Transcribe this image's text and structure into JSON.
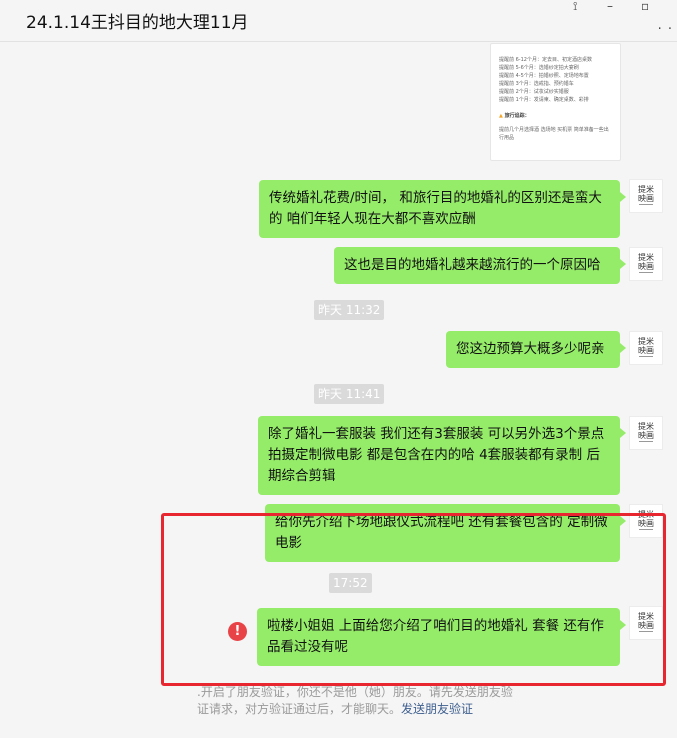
{
  "window": {
    "title": "24.1.14王抖目的地大理11月",
    "pin_glyph": "⟟",
    "minimize_glyph": "–",
    "maximize_glyph": "▫",
    "more_glyph": "· ·"
  },
  "avatar": {
    "line1": "提米",
    "line2": "映画"
  },
  "preview_card": {
    "lines": [
      "提醒前 6-12个月：定去目、初定酒店桌数",
      "提醒前 5-6个月：选婚纱定拍大宴刷",
      "提醒前 4-5个月：拍婚纱照、定场地布置",
      "提醒前 3个月：选戒指、预约婚车",
      "提醒前 2个月：试妆试纱实婚服",
      "提醒前 1个月：发请柬、确定桌数、彩排"
    ],
    "warn_title": "旅行追踪：",
    "tail_text": "提前几个月选择酒 选场地 买机票 简单准备一些出行用品"
  },
  "messages": [
    {
      "id": "msg1",
      "text": "传统婚礼花费/时间， 和旅行目的地婚礼的区别还是蛮大的  咱们年轻人现在大都不喜欢应酬"
    },
    {
      "id": "msg2",
      "text": "这也是目的地婚礼越来越流行的一个原因哈"
    },
    {
      "id": "time1",
      "text": "昨天 11:32"
    },
    {
      "id": "msg3",
      "text": "您这边预算大概多少呢亲"
    },
    {
      "id": "time2",
      "text": "昨天 11:41"
    },
    {
      "id": "msg4",
      "text": "除了婚礼一套服装 我们还有3套服装 可以另外选3个景点 拍摄定制微电影   都是包含在内的哈  4套服装都有录制  后期综合剪辑"
    },
    {
      "id": "msg5",
      "text": "给你先介绍下场地跟仪式流程吧  还有套餐包含的 定制微电影"
    },
    {
      "id": "time3",
      "text": "17:52"
    },
    {
      "id": "msg6",
      "text": "啦楼小姐姐  上面给您介绍了咱们目的地婚礼 套餐  还有作品看过没有呢"
    }
  ],
  "error_icon": "!",
  "system_note": {
    "text": ".开启了朋友验证，你还不是他（她）朋友。请先发送朋友验证请求，对方验证通过后，才能聊天。",
    "link": "发送朋友验证"
  },
  "colors": {
    "bubble": "#95ec69",
    "background": "#f5f5f5",
    "highlight_border": "#e8262f",
    "error": "#e84346",
    "link": "#3e5f8f"
  }
}
